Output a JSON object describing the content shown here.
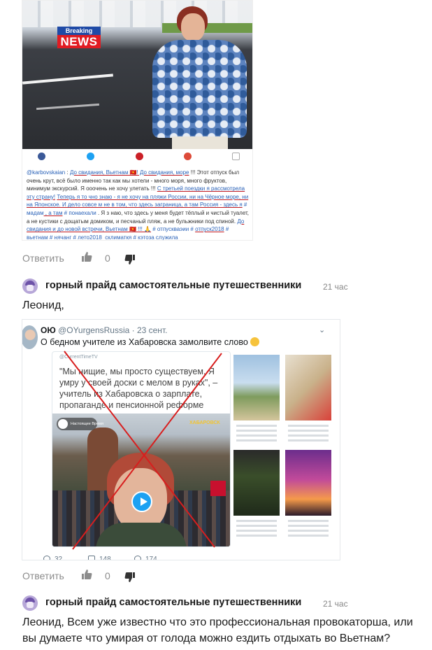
{
  "news_image": {
    "breaking_label": "Breaking",
    "news_label": "NEWS",
    "caption_parts": [
      {
        "t": "@karbovskaian",
        "c": "b"
      },
      {
        "t": " : ",
        "c": ""
      },
      {
        "t": "До свидания, Вьетнам 🇻🇳! До свидания, море",
        "c": "u"
      },
      {
        "t": " !!! Этот отпуск был очень крут, всё было именно так как мы хотели - много моря, много фруктов, минимум экскурсий. Я ооочень не хочу улетать !!! ",
        "c": ""
      },
      {
        "t": "С третьей поездки я рассмотрела эту страну!",
        "c": "u"
      },
      {
        "t": " ",
        "c": ""
      },
      {
        "t": "Теперь я то чно знаю - я не хочу на пляжи России, ни на Чёрное море, ни на Японское. И дело совсе м не в том, что здесь заграница, а там Россия - здесь я",
        "c": "u"
      },
      {
        "t": " # мадам",
        "c": "b"
      },
      {
        "t": " , а там",
        "c": "u"
      },
      {
        "t": " # понаехали",
        "c": "b"
      },
      {
        "t": " . Я з наю, что здесь у меня будет тёплый и чистый туалет, а не кустики с дощатым домиком, и песчаный пляж, а не бульжники под спиной. ",
        "c": ""
      },
      {
        "t": "До свидания и до новой встречи, Вьетнам 🇻🇳 !!! 🙏",
        "c": "u"
      },
      {
        "t": " # отпускваэии # ",
        "c": "b"
      },
      {
        "t": "отпуск2018",
        "c": "u"
      },
      {
        "t": " # ",
        "c": "b"
      },
      {
        "t": "вьетнам",
        "c": "u"
      },
      {
        "t": " # нячанг # лето2018_склиматкя # кэтоза служила",
        "c": "b"
      }
    ]
  },
  "comments": [
    {
      "reply_label": "Ответить",
      "likes": "0"
    },
    {
      "author": "горный прайд самостоятельные путешественники",
      "time": "21 час",
      "text": "Леонид,",
      "reply_label": "Ответить",
      "likes": "0"
    },
    {
      "author": "горный прайд самостоятельные путешественники",
      "time": "21 час",
      "text": "Леонид, Всем уже известно что это профессиональная провокаторша, или вы думаете что умирая от голода можно ездить отдыхать во Вьетнам?"
    }
  ],
  "tweet": {
    "name": "ОЮ",
    "handle_date": "@OYurgensRussia · 23 сент.",
    "text": "О бедном учителе из Хабаровска замолвите слово",
    "quote_source": "@CurrentTimeTV",
    "quote_text": "\"Мы нищие, мы просто существуем. Я умру у своей доски с мелом в руках\", – учитель из Хабаровска о зарплате, пропаганде и пенсионной реформе",
    "video_logo": "Настоящее Время",
    "video_place": "ХАБАРОВСК",
    "stats": {
      "replies": "32",
      "retweets": "148",
      "likes": "174"
    }
  },
  "colors": {
    "link_blue": "#2a62b8",
    "underline_red": "#c0171e",
    "cross_red": "#d81e1e",
    "twitter_blue": "#1da1f2",
    "meta_gray": "#8c8c8c"
  },
  "icons": [
    "facebook-icon",
    "twitter-icon",
    "pinterest-icon",
    "google-plus-icon",
    "share-icon",
    "thumb-up-icon",
    "thumb-down-icon",
    "avatar-icon",
    "chevron-down-icon",
    "play-icon",
    "reply-icon",
    "retweet-icon",
    "heart-icon"
  ]
}
